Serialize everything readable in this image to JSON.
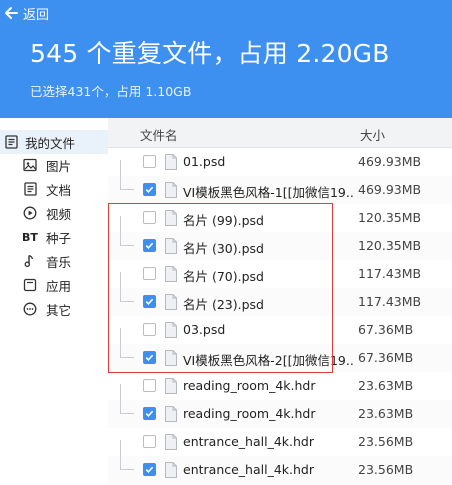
{
  "header": {
    "back_label": "返回",
    "title": "545 个重复文件，占用 2.20GB",
    "subtitle": "已选择431个，占用 1.10GB",
    "bg_color": "#3d8ff0"
  },
  "sidebar": {
    "root": {
      "label": "我的文件",
      "icon": "document-icon"
    },
    "items": [
      {
        "label": "图片",
        "icon": "image-icon"
      },
      {
        "label": "文档",
        "icon": "document-icon"
      },
      {
        "label": "视频",
        "icon": "play-icon"
      },
      {
        "label": "种子",
        "icon": "bt-icon"
      },
      {
        "label": "音乐",
        "icon": "music-note-icon"
      },
      {
        "label": "应用",
        "icon": "app-icon"
      },
      {
        "label": "其它",
        "icon": "more-icon"
      }
    ]
  },
  "columns": {
    "name": "文件名",
    "size": "大小"
  },
  "files": [
    {
      "name": "01.psd",
      "size": "469.93MB",
      "checked": false
    },
    {
      "name": "VI模板黑色风格-1[[加微信19...",
      "size": "469.93MB",
      "checked": true
    },
    {
      "name": "名片 (99).psd",
      "size": "120.35MB",
      "checked": false
    },
    {
      "name": "名片 (30).psd",
      "size": "120.35MB",
      "checked": true
    },
    {
      "name": "名片 (70).psd",
      "size": "117.43MB",
      "checked": false
    },
    {
      "name": "名片 (23).psd",
      "size": "117.43MB",
      "checked": true
    },
    {
      "name": "03.psd",
      "size": "67.36MB",
      "checked": false
    },
    {
      "name": "VI模板黑色风格-2[[加微信19...",
      "size": "67.36MB",
      "checked": true
    },
    {
      "name": "reading_room_4k.hdr",
      "size": "23.63MB",
      "checked": false
    },
    {
      "name": "reading_room_4k.hdr",
      "size": "23.63MB",
      "checked": true
    },
    {
      "name": "entrance_hall_4k.hdr",
      "size": "23.56MB",
      "checked": false
    },
    {
      "name": "entrance_hall_4k.hdr",
      "size": "23.56MB",
      "checked": true
    }
  ],
  "colors": {
    "accent": "#3d8ff0",
    "highlight_border": "#e23b3b"
  }
}
